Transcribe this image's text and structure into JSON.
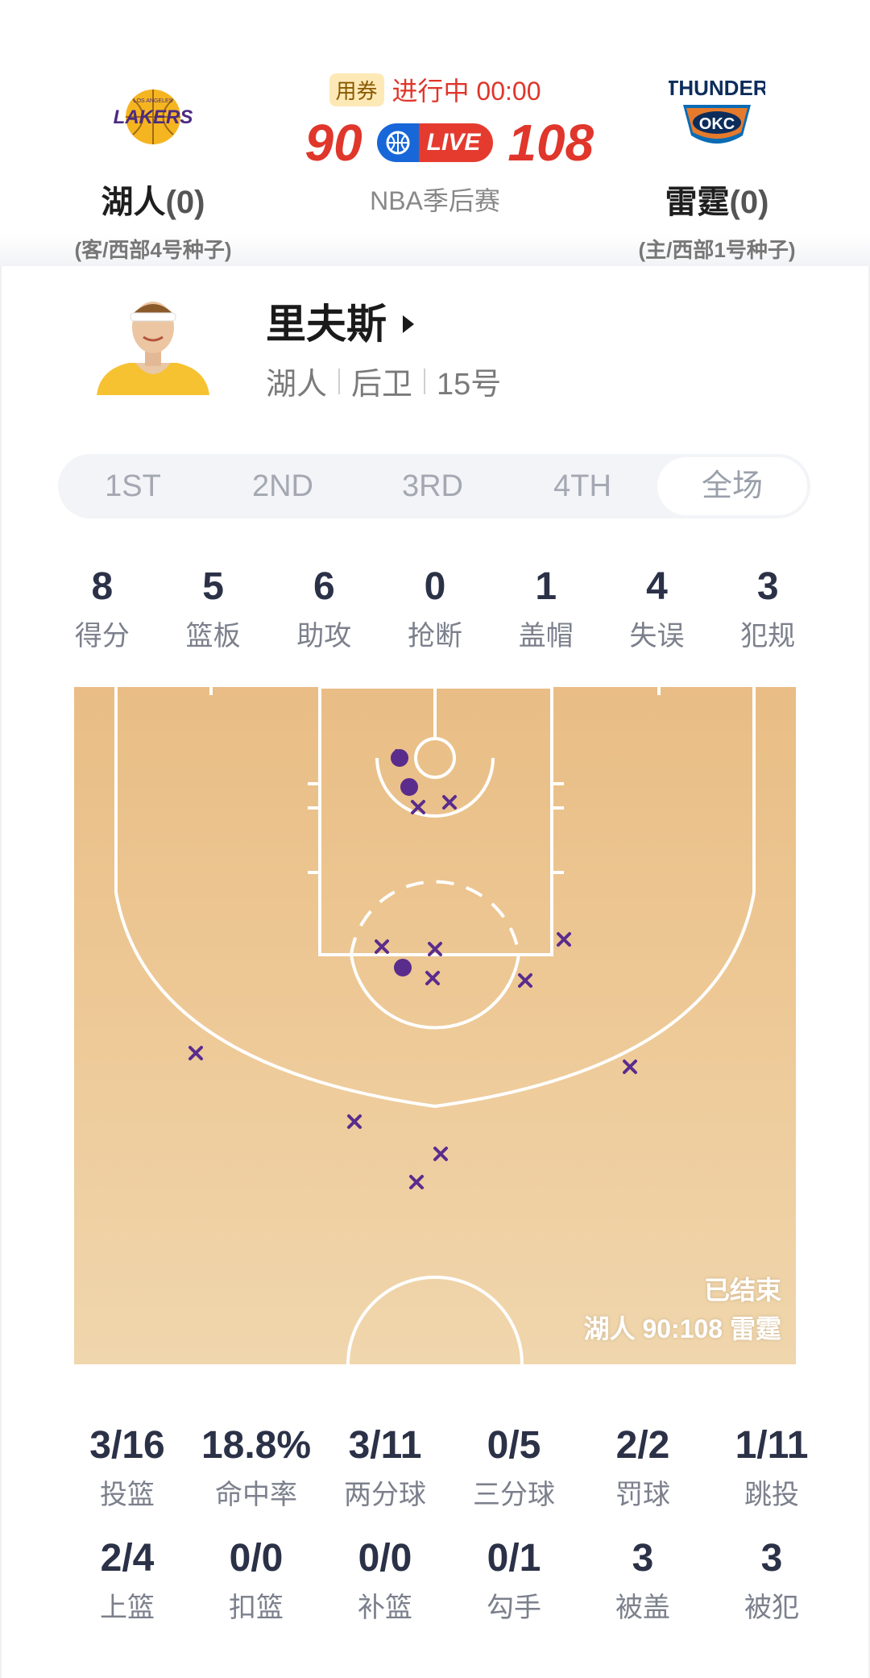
{
  "match": {
    "coupon": "用券",
    "status": "进行中 00:00",
    "away_score": "90",
    "home_score": "108",
    "live_label": "LIVE",
    "league": "NBA季后赛",
    "away": {
      "name": "湖人",
      "wins": "(0)",
      "seed": "(客/西部4号种子)",
      "logo": "lakers-logo",
      "logo_text": "LAKERS",
      "logo_small": "LOS ANGELES"
    },
    "home": {
      "name": "雷霆",
      "wins": "(0)",
      "seed": "(主/西部1号种子)",
      "logo": "thunder-logo",
      "logo_text": "THUNDER",
      "logo_small": "OKC"
    }
  },
  "player": {
    "name": "里夫斯",
    "team": "湖人",
    "position": "后卫",
    "number": "15号"
  },
  "tabs": [
    "1ST",
    "2ND",
    "3RD",
    "4TH",
    "全场"
  ],
  "active_tab": "全场",
  "summary_stats": [
    {
      "value": "8",
      "label": "得分"
    },
    {
      "value": "5",
      "label": "篮板"
    },
    {
      "value": "6",
      "label": "助攻"
    },
    {
      "value": "0",
      "label": "抢断"
    },
    {
      "value": "1",
      "label": "盖帽"
    },
    {
      "value": "4",
      "label": "失误"
    },
    {
      "value": "3",
      "label": "犯规"
    }
  ],
  "court": {
    "status": "已结束",
    "final": "湖人 90:108 雷霆",
    "colors": {
      "made": "#5a2c8c",
      "missed": "#5a2c8c"
    }
  },
  "shooting_stats_row1": [
    {
      "value": "3/16",
      "label": "投篮"
    },
    {
      "value": "18.8%",
      "label": "命中率"
    },
    {
      "value": "3/11",
      "label": "两分球"
    },
    {
      "value": "0/5",
      "label": "三分球"
    },
    {
      "value": "2/2",
      "label": "罚球"
    },
    {
      "value": "1/11",
      "label": "跳投"
    }
  ],
  "shooting_stats_row2": [
    {
      "value": "2/4",
      "label": "上篮"
    },
    {
      "value": "0/0",
      "label": "扣篮"
    },
    {
      "value": "0/0",
      "label": "补篮"
    },
    {
      "value": "0/1",
      "label": "勾手"
    },
    {
      "value": "3",
      "label": "被盖"
    },
    {
      "value": "3",
      "label": "被犯"
    }
  ]
}
